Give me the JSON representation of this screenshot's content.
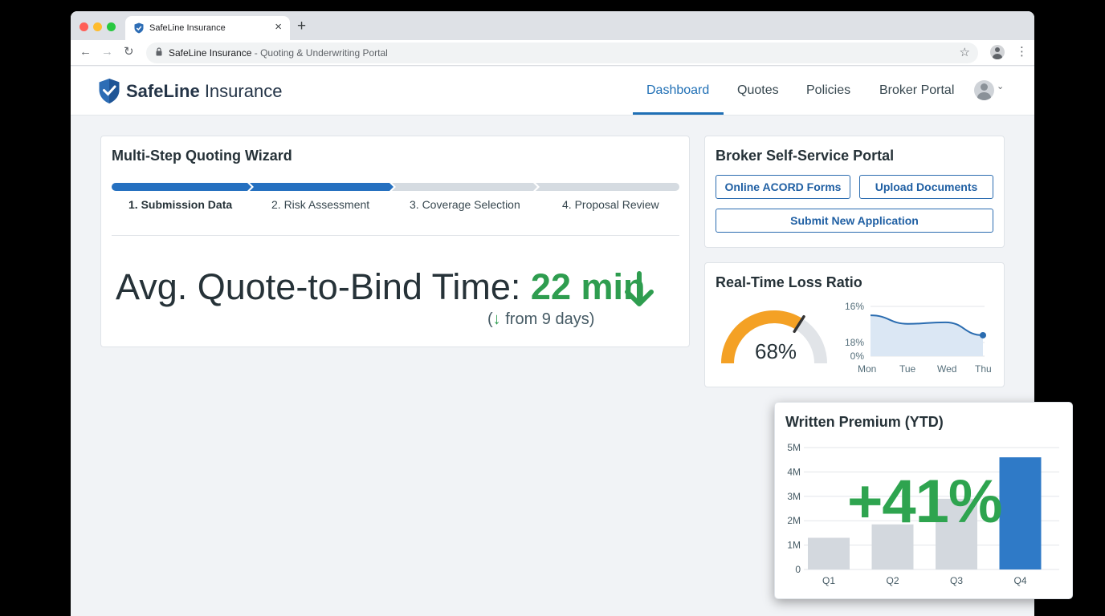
{
  "browser": {
    "tab_title": "SafeLine Insurance",
    "tab_close": "×",
    "new_tab": "+",
    "url_host": "SafeLine Insurance",
    "url_rest": " - Quoting & Underwriting Portal"
  },
  "header": {
    "brand_bold": "SafeLine",
    "brand_rest": " Insurance",
    "nav": [
      {
        "label": "Dashboard",
        "active": true
      },
      {
        "label": "Quotes",
        "active": false
      },
      {
        "label": "Policies",
        "active": false
      },
      {
        "label": "Broker Portal",
        "active": false
      }
    ]
  },
  "wizard": {
    "title": "Multi-Step Quoting Wizard",
    "steps": [
      {
        "label": "1. Submission Data",
        "state": "current"
      },
      {
        "label": "2. Risk Assessment",
        "state": "complete"
      },
      {
        "label": "3. Coverage Selection",
        "state": "pending"
      },
      {
        "label": "4. Proposal Review",
        "state": "pending"
      }
    ],
    "kpi_label": "Avg. Quote-to-Bind Time: ",
    "kpi_value": "22 min",
    "kpi_sub_open": "(",
    "kpi_sub_arrow": "↓",
    "kpi_sub_text": " from 9 days)"
  },
  "broker": {
    "title": "Broker Self-Service Portal",
    "buttons": {
      "acord": "Online ACORD Forms",
      "upload": "Upload Documents",
      "submit": "Submit New Application"
    }
  },
  "loss_ratio": {
    "title": "Real-Time Loss Ratio",
    "gauge_value": "68%",
    "gauge_fraction": 0.68,
    "chart_data": {
      "type": "area",
      "categories": [
        "Mon",
        "Tue",
        "Wed",
        "Thu"
      ],
      "y_ticks": [
        "16%",
        "18%",
        "0%"
      ],
      "series": [
        {
          "values": [
            0.82,
            0.65,
            0.68,
            0.42
          ]
        }
      ]
    }
  },
  "premium": {
    "title": "Written Premium (YTD)",
    "growth": "+41%",
    "chart_data": {
      "type": "bar",
      "categories": [
        "Q1",
        "Q2",
        "Q3",
        "Q4"
      ],
      "values": [
        1.3,
        1.85,
        2.9,
        4.6
      ],
      "y_ticks": [
        "5M",
        "4M",
        "3M",
        "2M",
        "1M",
        "0"
      ],
      "ylim": [
        0,
        5
      ],
      "highlight_color": "#2f7ac7",
      "bar_color": "#d3d8de"
    }
  },
  "colors": {
    "accent": "#1f6fb5",
    "positive": "#2e9d4f",
    "gauge": "#f4a125"
  }
}
